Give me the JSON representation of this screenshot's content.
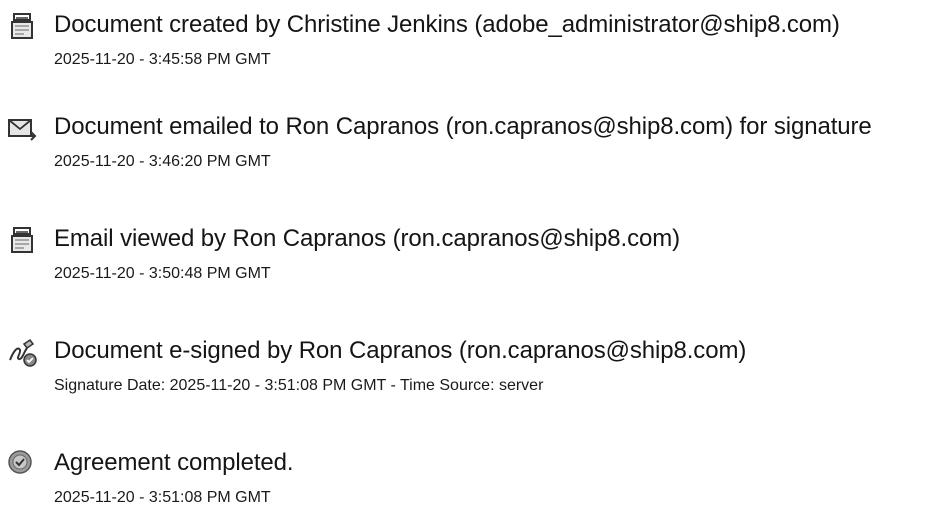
{
  "events": [
    {
      "icon": "document-created-icon",
      "title": "Document created by Christine Jenkins (adobe_administrator@ship8.com)",
      "timestamp": "2025-11-20 - 3:45:58 PM GMT"
    },
    {
      "icon": "document-emailed-icon",
      "title": "Document emailed to Ron Capranos (ron.capranos@ship8.com) for signature",
      "timestamp": "2025-11-20 - 3:46:20 PM GMT"
    },
    {
      "icon": "email-viewed-icon",
      "title": "Email viewed by Ron Capranos (ron.capranos@ship8.com)",
      "timestamp": "2025-11-20 - 3:50:48 PM GMT"
    },
    {
      "icon": "document-signed-icon",
      "title": "Document e-signed by Ron Capranos (ron.capranos@ship8.com)",
      "timestamp": "Signature Date: 2025-11-20 - 3:51:08 PM GMT - Time Source: server"
    },
    {
      "icon": "agreement-completed-icon",
      "title": "Agreement completed.",
      "timestamp": "2025-11-20 - 3:51:08 PM GMT"
    }
  ]
}
